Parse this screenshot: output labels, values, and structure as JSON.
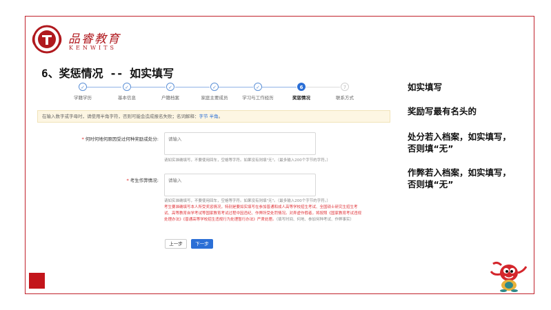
{
  "brand": {
    "name_cn": "品睿教育",
    "name_en": "KENWITS"
  },
  "slide_title": "6、奖惩情况 -- 如实填写",
  "steps": [
    {
      "label": "学籍学历",
      "state": "done",
      "icon": "check-icon"
    },
    {
      "label": "基本信息",
      "state": "done",
      "icon": "check-icon"
    },
    {
      "label": "户籍档案",
      "state": "done",
      "icon": "check-icon"
    },
    {
      "label": "家庭主要成员",
      "state": "done",
      "icon": "check-icon"
    },
    {
      "label": "学习与工作经历",
      "state": "done",
      "icon": "check-icon"
    },
    {
      "label": "奖惩情况",
      "state": "active",
      "number": "6"
    },
    {
      "label": "联系方式",
      "state": "todo",
      "number": "7"
    }
  ],
  "notice": {
    "text": "在输入数字或字母时，请使用半角字符，否则可能会造成报名失败；名词解释：",
    "link1": "字节",
    "link2": "半角",
    "end": "。"
  },
  "form": {
    "field1": {
      "label": "何时何地何原因受过何种奖励或处分:",
      "placeholder": "请输入",
      "hint": "请如实准确填写，不要使用回车，空格等字符。如果没有则填\"无\"。（最多输入200个字节的字符。）"
    },
    "field2": {
      "label": "考生作弊情况:",
      "placeholder": "请输入",
      "hint": "请如实准确填写，不要使用回车，空格等字符。如果没有则填\"无\"。（最多输入200个字节的字符。）",
      "warning": "考生要准确填写本人所受奖惩情况，特别是要如实填写在参加普通和成人高等学校招生考试、全国硕士研究生招生考试、高等教育自学考试等国家教育考试过程中因违纪、作弊所受处罚情况。对弄虚作假者，将按照《国家教育考试违规处理办法》《普通高等学校招生违规行为处理暂行办法》严肃处理。",
      "warning_tail": "（填写时间、何地、参加何种考试、作弊事实）"
    },
    "prev_label": "上一步",
    "next_label": "下一步"
  },
  "notes": [
    {
      "lines": [
        "如实填写"
      ]
    },
    {
      "lines": [
        "奖励写最有名头的"
      ]
    },
    {
      "lines": [
        "处分若入档案，如实填写，",
        "否则填“无”"
      ]
    },
    {
      "lines": [
        "作弊若入档案，如实填写，",
        "否则填“无”"
      ]
    }
  ],
  "colors": {
    "accent": "#2b6fd6",
    "brand_red": "#c3151b",
    "notice_bg": "#fdf6e3",
    "warning": "#e0353a"
  }
}
